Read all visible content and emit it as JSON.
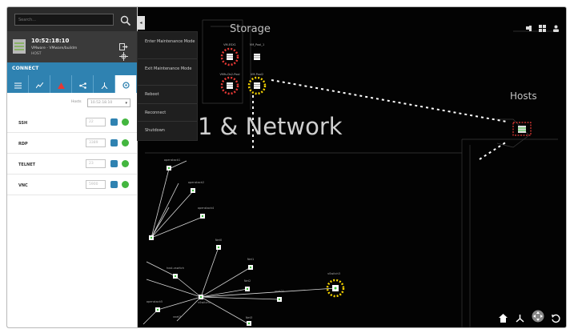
{
  "search": {
    "placeholder": "Search..."
  },
  "host": {
    "time": "10:52:18:10",
    "name": "VMware - VMware/buildm",
    "type": "HOST"
  },
  "connect": {
    "label": "CONNECT",
    "tabs": [
      "list-icon",
      "chart-icon",
      "alert-icon",
      "share-icon",
      "topology-icon",
      "settings-icon"
    ],
    "ports_label": "Hosts",
    "ports_value": "10.52.18.10",
    "protocols": [
      {
        "name": "SSH",
        "port": "22"
      },
      {
        "name": "RDP",
        "port": "3389"
      },
      {
        "name": "TELNET",
        "port": "23"
      },
      {
        "name": "VNC",
        "port": "5900"
      }
    ]
  },
  "context_menu": {
    "items": [
      "Enter Maintenance Mode",
      "Exit Maintenance Mode",
      "Reboot",
      "Reconnect",
      "Shutdown"
    ]
  },
  "canvas": {
    "storage_title": "Storage",
    "hosts_title": "Hosts",
    "section_title": "1 & Network",
    "storage_nodes": [
      "VM-ESX1",
      "VM_Pool_1",
      "VMfs-Ds2-Pool",
      "VM-Pool2"
    ],
    "network_nodes": [
      "openstack1",
      "openstack2",
      "openstack3",
      "openstack4",
      "openstack5",
      "host-vswitch",
      "vSwitch1",
      "vSwitch2",
      "Net0",
      "Net1",
      "Net2",
      "vnet21",
      "vnet3",
      "Net3",
      "Net4",
      "vSwitch3"
    ],
    "colors": {
      "alert_red": "#e53935",
      "warn_yellow": "#f5d300",
      "link_green": "#3cc13b",
      "accent_blue": "#2f82b1"
    }
  }
}
